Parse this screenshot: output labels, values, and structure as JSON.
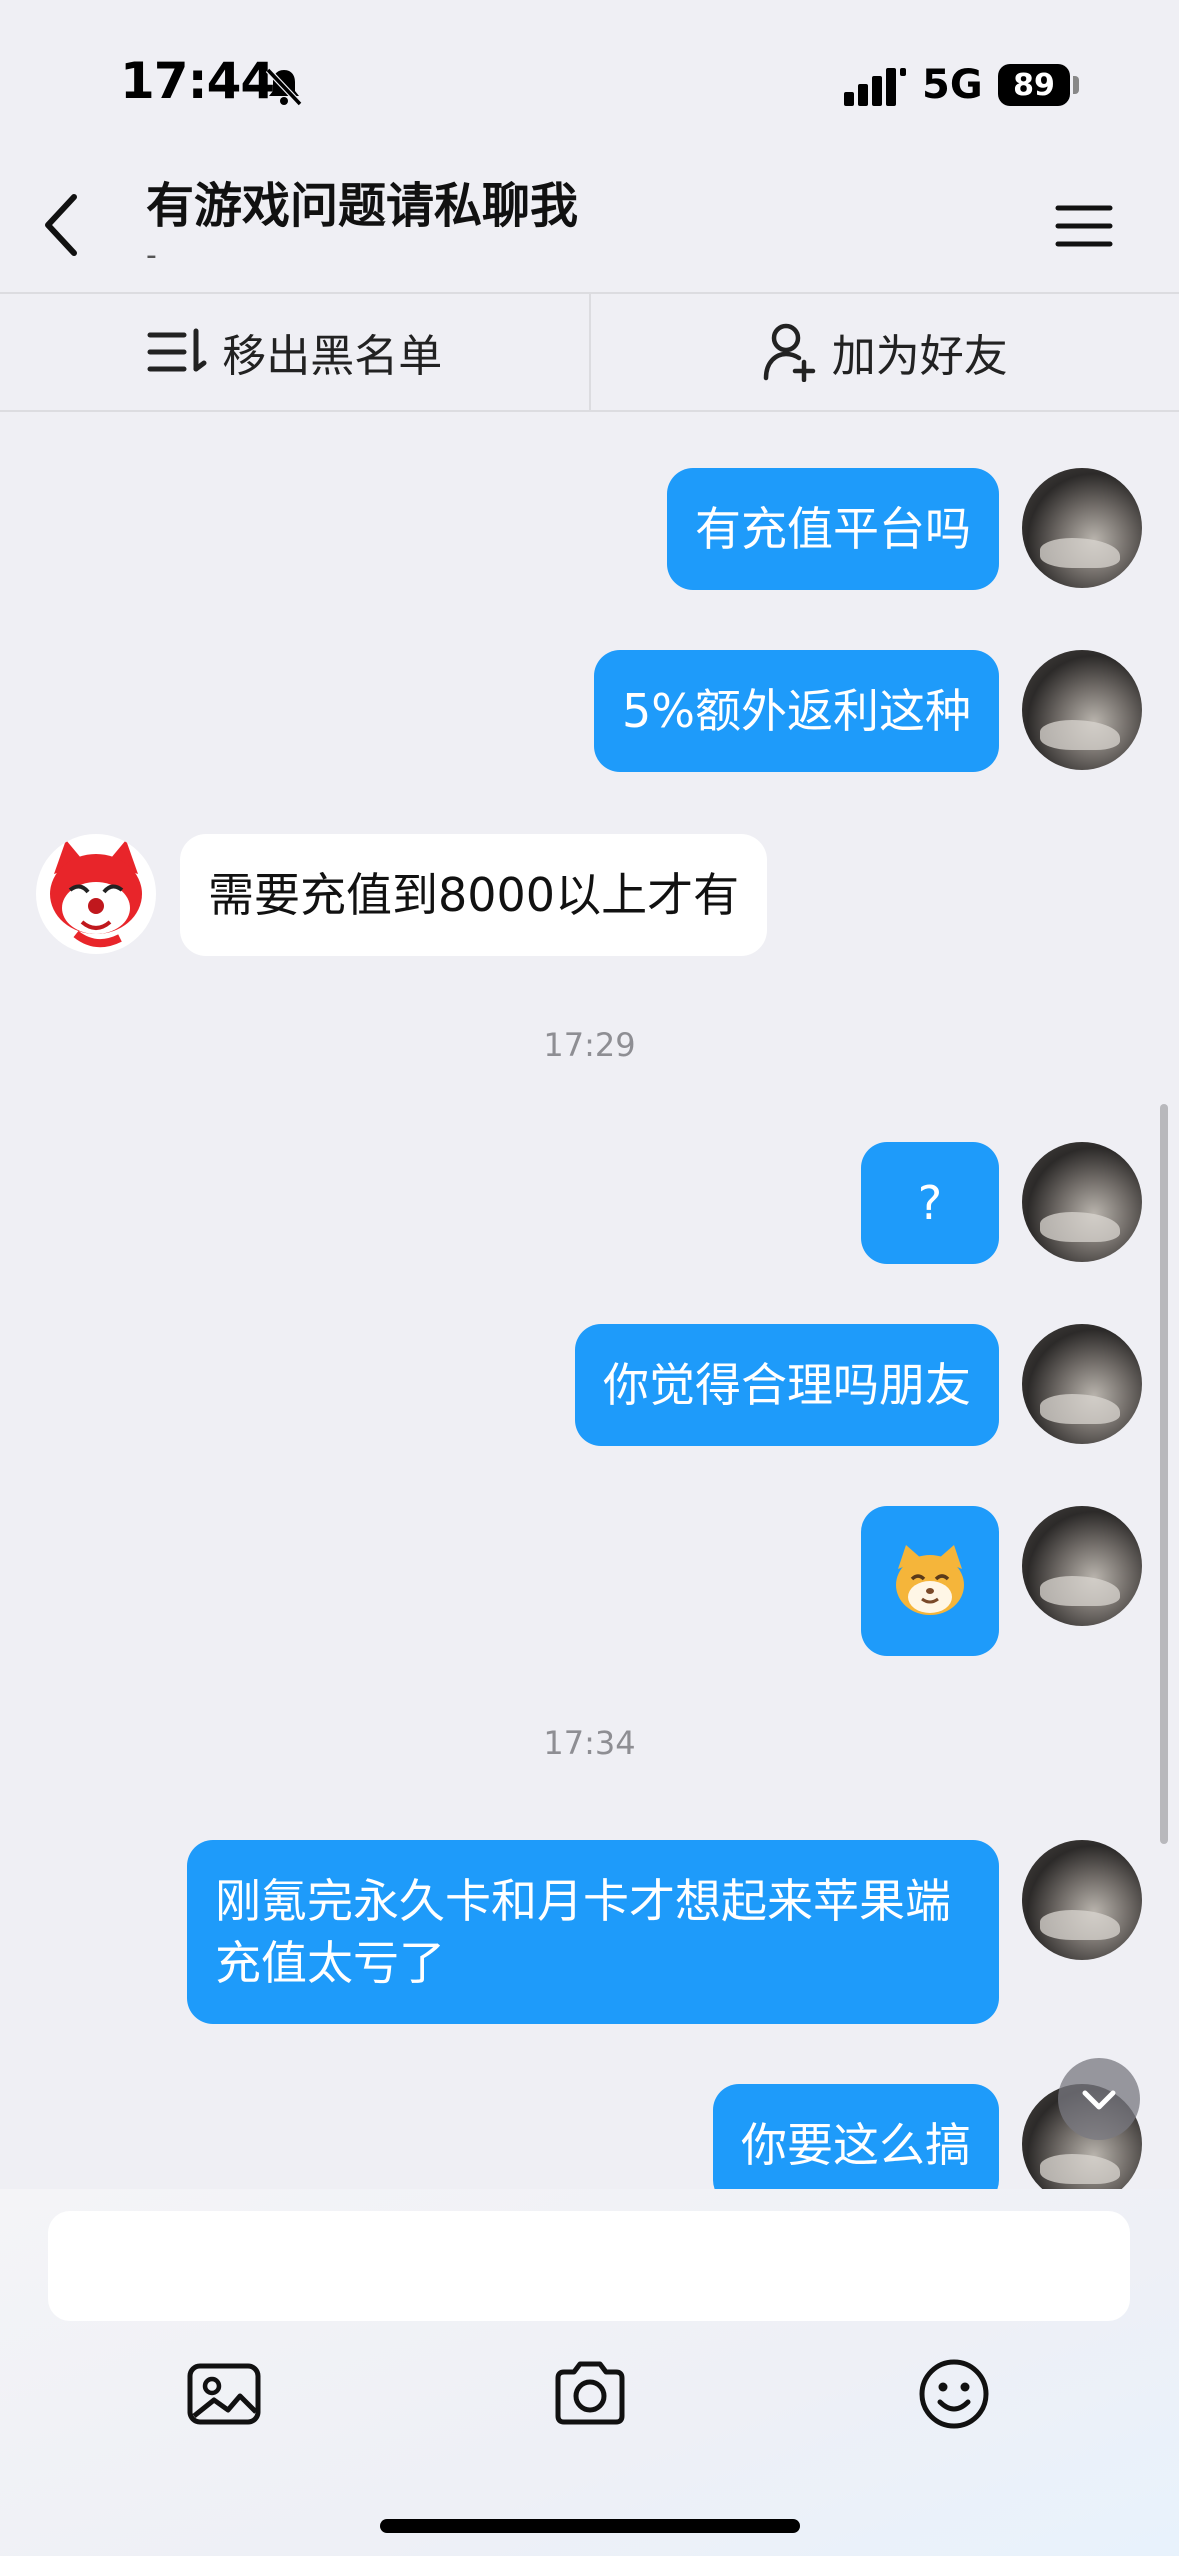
{
  "status_bar": {
    "time": "17:44",
    "network": "5G",
    "battery": "89"
  },
  "header": {
    "title": "有游戏问题请私聊我",
    "subtitle": "-"
  },
  "actions": {
    "remove_blacklist": "移出黑名单",
    "add_friend": "加为好友"
  },
  "messages": [
    {
      "side": "out",
      "text": "有充值平台吗"
    },
    {
      "side": "out",
      "text": "5%额外返利这种"
    },
    {
      "side": "in",
      "text": "需要充值到8000以上才有"
    },
    {
      "type": "time",
      "text": "17:29"
    },
    {
      "side": "out",
      "text": "?"
    },
    {
      "side": "out",
      "text": "你觉得合理吗朋友"
    },
    {
      "side": "out",
      "sticker": "cat-face-emoji"
    },
    {
      "type": "time",
      "text": "17:34"
    },
    {
      "side": "out",
      "text": "刚氪完永久卡和月卡才想起来苹果端充值太亏了"
    },
    {
      "side": "out",
      "text": "你要这么搞"
    }
  ],
  "input": {
    "placeholder": ""
  },
  "icons": {
    "bottom": [
      "image-icon",
      "camera-icon",
      "emoji-icon"
    ]
  },
  "colors": {
    "outgoing_bubble": "#1e9bfa",
    "incoming_bubble": "#ffffff",
    "background": "#efeff4"
  }
}
